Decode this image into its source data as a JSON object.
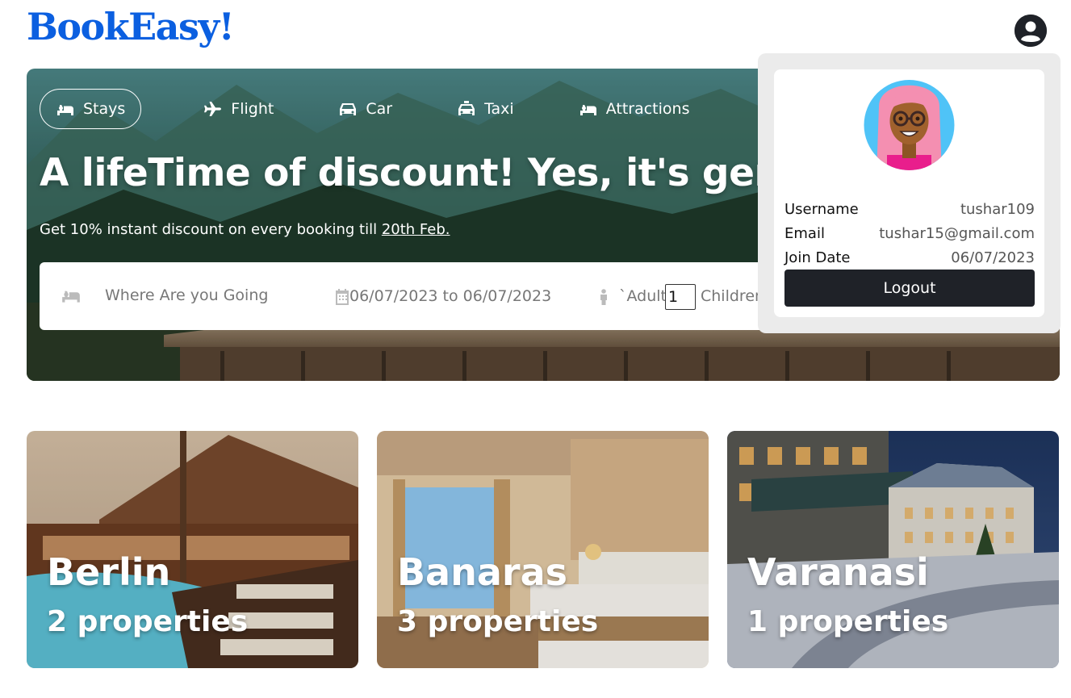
{
  "brand": {
    "logo": "BookEasy!",
    "color": "#0b5fe0"
  },
  "header": {
    "user_icon": "user-circle-icon"
  },
  "hero": {
    "tabs": [
      {
        "label": "Stays",
        "icon": "bed-icon",
        "active": true
      },
      {
        "label": "Flight",
        "icon": "plane-icon",
        "active": false
      },
      {
        "label": "Car",
        "icon": "car-icon",
        "active": false
      },
      {
        "label": "Taxi",
        "icon": "taxi-icon",
        "active": false
      },
      {
        "label": "Attractions",
        "icon": "bed-icon",
        "active": false
      }
    ],
    "headline": "A lifeTime of discount! Yes, it's genius.",
    "subline_text": "Get 10% instant discount on every booking till ",
    "subline_date": "20th Feb."
  },
  "search": {
    "destination_placeholder": "Where Are you Going",
    "date_range": "06/07/2023 to 06/07/2023",
    "adult_label": "`Adult",
    "adult_value": "1",
    "children_label": "Children"
  },
  "profile": {
    "username_label": "Username",
    "username": "tushar109",
    "email_label": "Email",
    "email": "tushar15@gmail.com",
    "join_label": "Join Date",
    "join_date": "06/07/2023",
    "logout_label": "Logout"
  },
  "cities": [
    {
      "name": "Berlin",
      "properties": "2 properties"
    },
    {
      "name": "Banaras",
      "properties": "3 properties"
    },
    {
      "name": "Varanasi",
      "properties": "1 properties"
    }
  ]
}
